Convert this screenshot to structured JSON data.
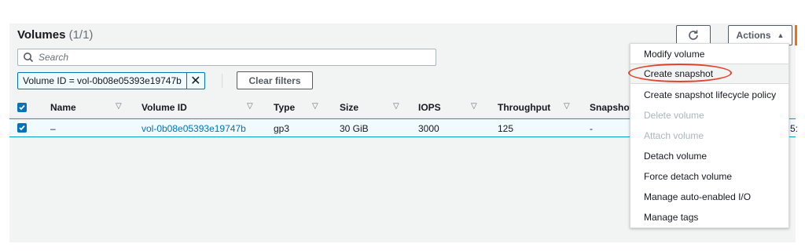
{
  "header": {
    "title": "Volumes",
    "count": "(1/1)",
    "actions_label": "Actions"
  },
  "search": {
    "placeholder": "Search",
    "value": ""
  },
  "filter": {
    "token": "Volume ID = vol-0b08e05393e19747b",
    "clear_label": "Clear filters"
  },
  "table": {
    "columns": [
      "Name",
      "Volume ID",
      "Type",
      "Size",
      "IOPS",
      "Throughput",
      "Snapshot"
    ],
    "rows": [
      {
        "selected": true,
        "name": "–",
        "volume_id": "vol-0b08e05393e19747b",
        "type": "gp3",
        "size": "30 GiB",
        "iops": "3000",
        "throughput": "125",
        "snapshot": "-"
      }
    ],
    "clipped_trailing_text": "5:"
  },
  "menu": {
    "items": [
      {
        "label": "Modify volume",
        "disabled": false
      },
      {
        "label": "Create snapshot",
        "disabled": false,
        "highlighted": true
      },
      {
        "label": "Create snapshot lifecycle policy",
        "disabled": false
      },
      {
        "label": "Delete volume",
        "disabled": true
      },
      {
        "label": "Attach volume",
        "disabled": true
      },
      {
        "label": "Detach volume",
        "disabled": false
      },
      {
        "label": "Force detach volume",
        "disabled": false
      },
      {
        "label": "Manage auto-enabled I/O",
        "disabled": false
      },
      {
        "label": "Manage tags",
        "disabled": false
      }
    ]
  },
  "colors": {
    "link": "#0073bb",
    "checkbox": "#0073bb",
    "annotation": "#e0452b",
    "primary_edge": "#ec7211"
  },
  "icons": {
    "refresh": "refresh-icon",
    "search": "search-icon",
    "dismiss": "close-icon",
    "sort": "sort-down-icon",
    "caret": "caret-up-icon"
  }
}
